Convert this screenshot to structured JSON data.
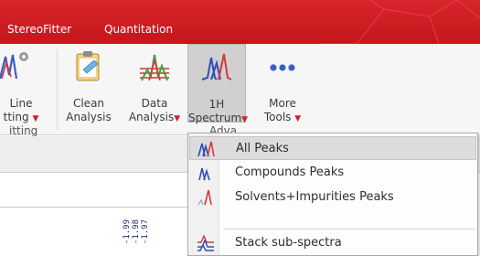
{
  "tabs": {
    "stereofitter": "StereoFitter",
    "quantitation": "Quantitation"
  },
  "ribbon": {
    "line_fitting": {
      "line1": "Line",
      "line2": "tting"
    },
    "clean_analysis": {
      "line1": "Clean",
      "line2": "Analysis"
    },
    "data_analysis": {
      "line1": "Data",
      "line2": "Analysis"
    },
    "spectrum_1h": {
      "line1": "1H",
      "line2": "Spectrum"
    },
    "more_tools": {
      "line1": "More",
      "line2": "Tools"
    },
    "group_fitting": "itting",
    "group_advanced": "Adva"
  },
  "menu": {
    "items": [
      {
        "label": "All Peaks",
        "icon": "all-peaks-icon",
        "highlighted": true
      },
      {
        "label": "Compounds Peaks",
        "icon": "compounds-peaks-icon"
      },
      {
        "label": "Solvents+Impurities Peaks",
        "icon": "solvents-peaks-icon"
      },
      {
        "label": "Stack sub-spectra",
        "icon": "stack-subspectra-icon"
      }
    ]
  },
  "axis_ticks": [
    "-1.99",
    "-1.98",
    "-1.97"
  ],
  "colors": {
    "brand_red": "#c5161c",
    "accent_dropdown": "#d0202a",
    "tick_blue": "#1a2a7a"
  }
}
